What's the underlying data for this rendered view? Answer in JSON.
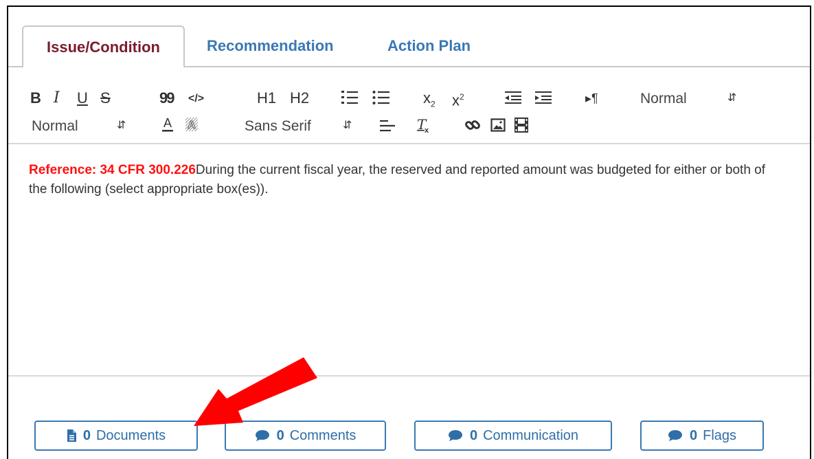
{
  "tabs": [
    {
      "label": "Issue/Condition",
      "active": true
    },
    {
      "label": "Recommendation",
      "active": false
    },
    {
      "label": "Action Plan",
      "active": false
    }
  ],
  "toolbar": {
    "bold": "B",
    "italic": "I",
    "underline": "U",
    "strike": "S",
    "blockquote": "99",
    "code": "</>",
    "h1": "H1",
    "h2": "H2",
    "header_select": {
      "value": "Normal"
    },
    "size_select": {
      "value": "Normal"
    },
    "font_select": {
      "value": "Sans Serif"
    }
  },
  "editor": {
    "reference": "Reference: 34 CFR 300.226",
    "body": "During the current fiscal year, the reserved and reported amount was budgeted for either or both of the following (select appropriate box(es))."
  },
  "footer": {
    "documents": {
      "count": "0",
      "label": "Documents",
      "icon": "file-icon"
    },
    "comments": {
      "count": "0",
      "label": "Comments",
      "icon": "comment-icon"
    },
    "communication": {
      "count": "0",
      "label": "Communication",
      "icon": "comment-icon"
    },
    "flags": {
      "count": "0",
      "label": "Flags",
      "icon": "comment-icon"
    }
  },
  "colors": {
    "tab_active": "#7a1c2c",
    "tab_inactive": "#3a78b4",
    "reference": "#ff1010",
    "button_border": "#3a78b4",
    "arrow": "#ff0000"
  }
}
